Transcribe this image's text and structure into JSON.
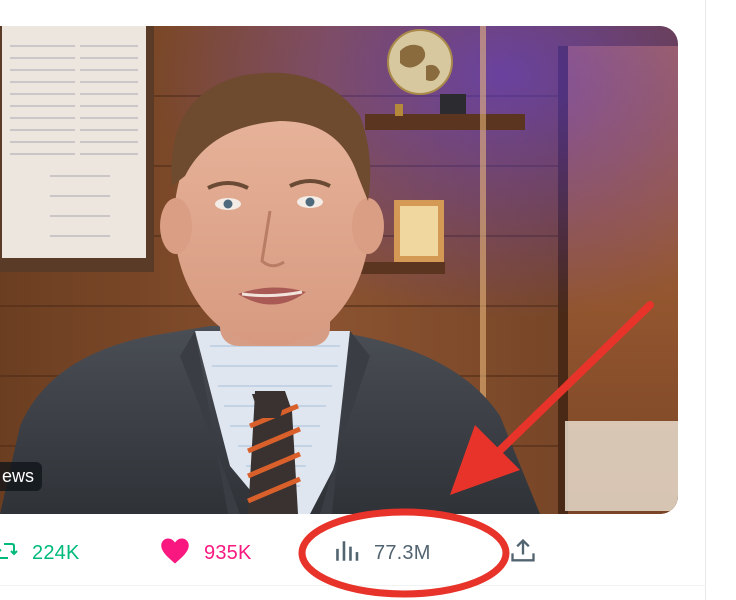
{
  "media": {
    "badge_text": "ews"
  },
  "actions": {
    "retweet_count": "224K",
    "like_count": "935K",
    "view_count": "77.3M"
  },
  "colors": {
    "retweet": "#00ba7c",
    "like": "#f91880",
    "muted": "#536471",
    "annotation": "#e8332a"
  },
  "icons": [
    "retweet-icon",
    "heart-icon",
    "views-icon",
    "share-icon",
    "annotation-arrow",
    "annotation-circle"
  ]
}
